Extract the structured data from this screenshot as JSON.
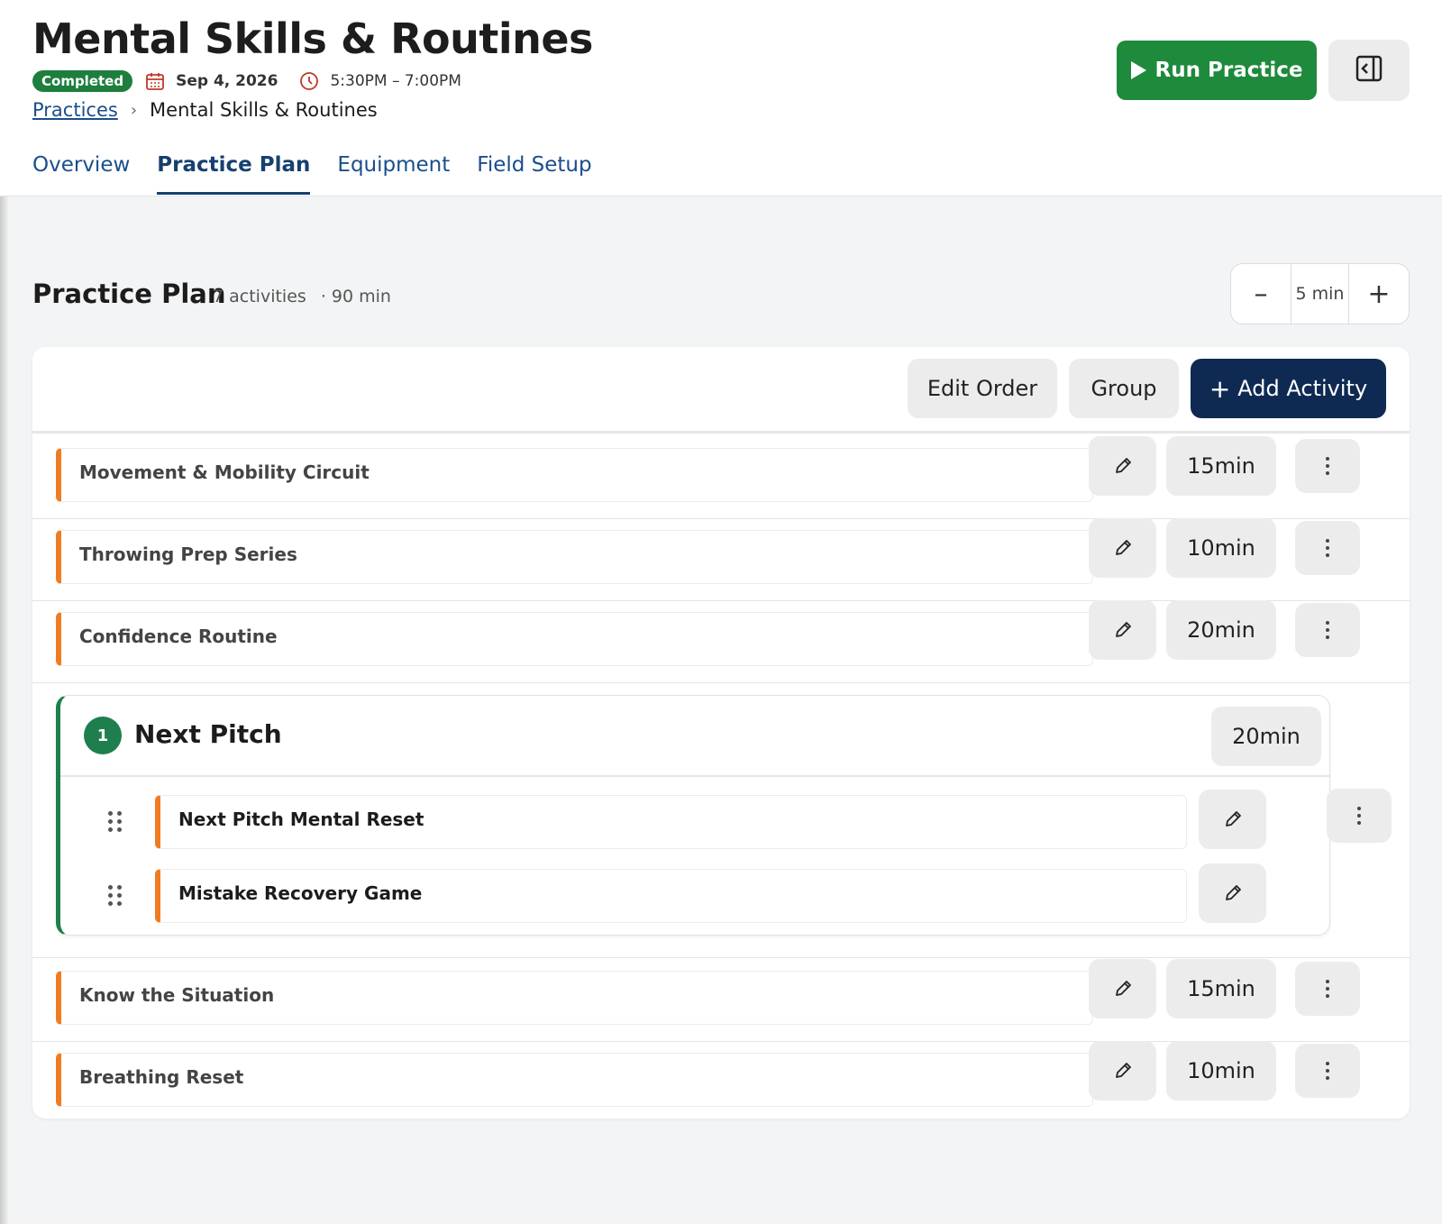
{
  "header": {
    "title": "Mental Skills & Routines",
    "status_badge": "Completed",
    "date": "Sep 4, 2026",
    "time": "5:30PM – 7:00PM",
    "breadcrumb": {
      "parent": "Practices",
      "separator": "›",
      "current": "Mental Skills & Routines"
    },
    "run_button": "Run Practice",
    "accent_green": "#1e8a3c",
    "navy": "#0e2a52"
  },
  "tabs": [
    {
      "label": "Overview",
      "active": false
    },
    {
      "label": "Practice Plan",
      "active": true
    },
    {
      "label": "Equipment",
      "active": false
    },
    {
      "label": "Field Setup",
      "active": false
    }
  ],
  "plan": {
    "title": "Practice Plan",
    "activity_count": "7 activities",
    "total": "· 90 min",
    "stepper": {
      "minus": "–",
      "value": "5 min",
      "plus": "+"
    },
    "toolbar": {
      "edit_order": "Edit Order",
      "group": "Group",
      "add_activity_icon": "+",
      "add_activity": "Add Activity"
    },
    "activities_before": [
      {
        "name": "Movement & Mobility Circuit",
        "duration": "15min"
      },
      {
        "name": "Throwing Prep Series",
        "duration": "10min"
      },
      {
        "name": "Confidence Routine",
        "duration": "20min"
      }
    ],
    "group": {
      "number": "1",
      "title": "Next Pitch",
      "duration": "20min",
      "items": [
        {
          "name": "Next Pitch Mental Reset"
        },
        {
          "name": "Mistake Recovery Game"
        }
      ]
    },
    "activities_after": [
      {
        "name": "Know the Situation",
        "duration": "15min"
      },
      {
        "name": "Breathing Reset",
        "duration": "10min"
      }
    ]
  },
  "icons": {
    "calendar": "calendar-icon",
    "clock": "clock-icon",
    "play": "play-icon",
    "panel": "panel-toggle-icon",
    "edit": "pencil-icon",
    "more": "more-vertical-icon",
    "drag": "drag-handle-icon"
  }
}
